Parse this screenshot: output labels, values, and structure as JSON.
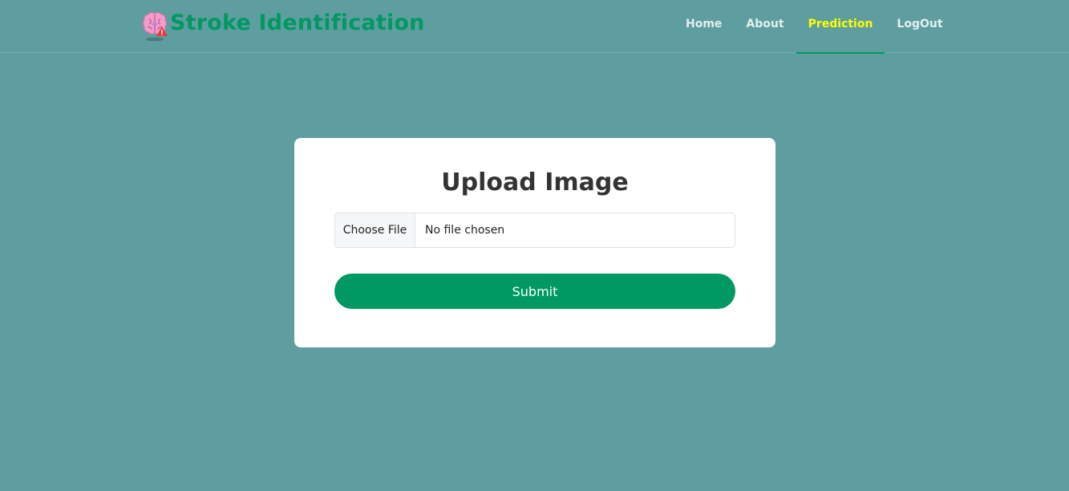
{
  "brand": {
    "title": "Stroke Identification",
    "logo_icon": "brain-alert-icon",
    "title_color": "#009961"
  },
  "nav": {
    "items": [
      {
        "label": "Home"
      },
      {
        "label": "About"
      },
      {
        "label": "Prediction",
        "active": true
      },
      {
        "label": "LogOut"
      }
    ],
    "active_color": "#ffff00",
    "underline_color": "#009961"
  },
  "upload": {
    "title": "Upload Image",
    "choose_file_label": "Choose File",
    "file_status": "No file chosen",
    "submit_label": "Submit",
    "submit_color": "#009961"
  },
  "colors": {
    "background": "#5f9ea0",
    "card": "#ffffff"
  }
}
